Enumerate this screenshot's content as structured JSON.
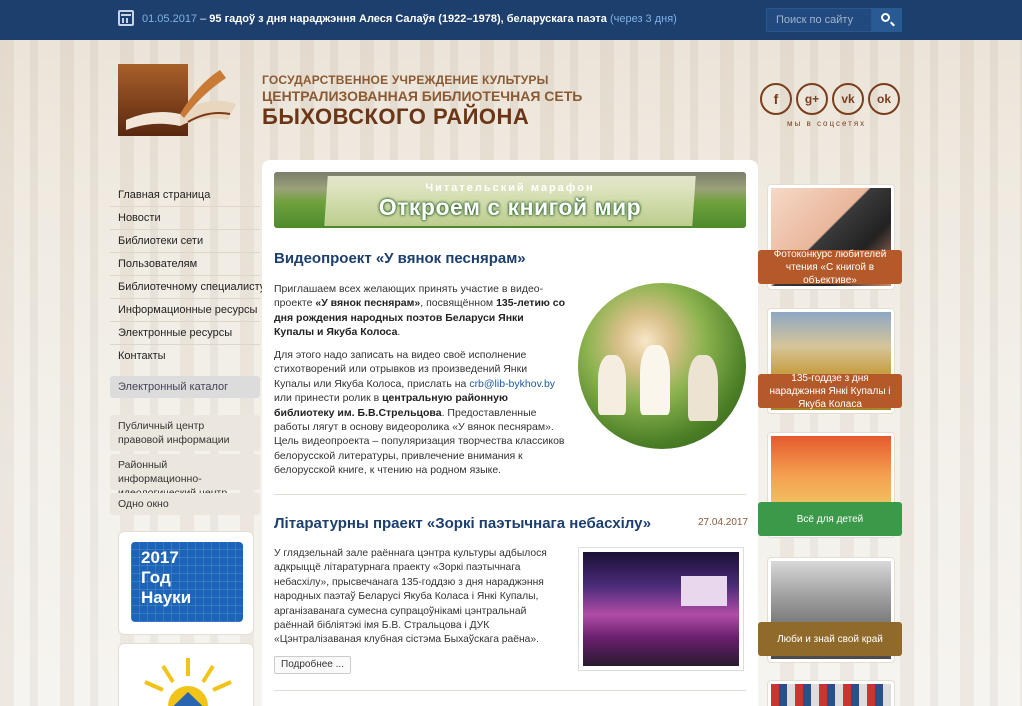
{
  "colors": {
    "topbar": "#1c3f6e",
    "brand_brown": "#6b3516",
    "accent_blue": "#1c3f6e",
    "label_orange": "#b45a2a",
    "label_green": "#3b9a4a",
    "label_olive": "#8f6a2a"
  },
  "topbar": {
    "date": "01.05.2017",
    "dash": " – ",
    "event": "95 гадоў з дня нараджэння Алеся Салаўя (1922–1978), беларускага паэта",
    "soon": "(через 3 дня)",
    "search_placeholder": "Поиск по сайту"
  },
  "header": {
    "org_line1": "ГОСУДАРСТВЕННОЕ УЧРЕЖДЕНИЕ КУЛЬТУРЫ",
    "org_line2": "ЦЕНТРАЛИЗОВАННАЯ БИБЛИОТЕЧНАЯ СЕТЬ",
    "org_line3": "БЫХОВСКОГО РАЙОНА",
    "social_caption": "мы в соцсетях",
    "social": [
      {
        "icon": "facebook-icon",
        "glyph": "f"
      },
      {
        "icon": "google-plus-icon",
        "glyph": "g+"
      },
      {
        "icon": "vk-icon",
        "glyph": "vk"
      },
      {
        "icon": "odnoklassniki-icon",
        "glyph": "ok"
      }
    ]
  },
  "menu": {
    "items": [
      "Главная страница",
      "Новости",
      "Библиотеки сети",
      "Пользователям",
      "Библиотечному специалисту",
      "Информационные ресурсы",
      "Электронные ресурсы",
      "Контакты"
    ],
    "catalog": "Электронный каталог",
    "box1": "Публичный центр правовой информации",
    "box2": "Районный информационно-идеологический центр",
    "box3": "Одно окно"
  },
  "side_banner": {
    "line1": "2017",
    "line2": "Год",
    "line3": "Науки"
  },
  "slider": {
    "line1": "Читательский марафон",
    "line2": "Откроем с книгой мир"
  },
  "article1": {
    "title": "Видеопроект «У вянок песнярам»",
    "p1_a": "Приглашаем всех желающих принять участие в видео-проекте ",
    "p1_b": "«У вянок песнярам»",
    "p1_c": ", посвящённом ",
    "p1_d": "135-летию со дня рождения народных поэтов Беларуси Янки Купалы и Якуба Колоса",
    "p1_e": ".",
    "p2_a": "Для этого надо записать на видео своё исполнение стихотворений или отрывков из произведений Янки Купалы или Якуба Колоса, прислать на ",
    "p2_link": "crb@lib-bykhov.by",
    "p2_b": " или принести ролик в ",
    "p2_c": "центральную районную библиотеку им. Б.В.Стрельцова",
    "p2_d": ". Предоставленные работы лягут в основу видеоролика «У вянок песнярам». Цель видеопроекта – популяризация творчества классиков белорусской литературы, привлечение внимания к белорусской книге, к чтению на родном языке."
  },
  "article2": {
    "title": "Літаратурны праект «Зоркі паэтычнага небасхілу»",
    "date": "27.04.2017",
    "text": "У глядзельнай зале раённага цэнтра культуры адбылося адкрыццё літаратурнага праекту «Зоркі паэтычнага небасхілу», прысвечанага 135-годдзю з дня нараджэння народных паэтаў Беларусі Якуба Коласа і Янкі Купалы, арганізаванага сумесна супрацоўнікамі цэнтральнай раённай бібліятэкі імя Б.В. Стральцова і ДУК «Цэнтралізаваная клубная сістэма Быхаўскага раёна».",
    "more": "Подробнее ..."
  },
  "right_cards": [
    {
      "label": "Фотоконкурс любителей чтения «С книгой в объективе»",
      "color": "#b45a2a"
    },
    {
      "label": "135-годдзе з дня нараджэння Янкі Купалы і Якуба Коласа",
      "color": "#b45a2a"
    },
    {
      "label": "Всё для детей",
      "color": "#3b9a4a"
    },
    {
      "label": "Люби и знай свой край",
      "color": "#8f6a2a"
    }
  ]
}
